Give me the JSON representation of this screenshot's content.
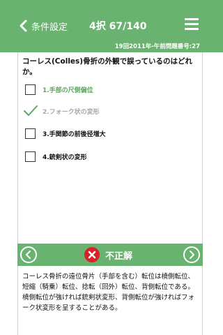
{
  "header": {
    "back_label": "条件設定",
    "counter": "4択 67/140",
    "exam_info": "19回2011年-午前問題番号:27"
  },
  "question": {
    "text": "コーレス(Colles)骨折の外観で誤っているのはどれか。"
  },
  "options": [
    {
      "label": "1.手部の尺側偏位",
      "state": "correct-answer",
      "checked": false
    },
    {
      "label": "2.フォーク状の変形",
      "state": "selected",
      "checked": true
    },
    {
      "label": "3.手関節の前後径増大",
      "state": "normal",
      "checked": false
    },
    {
      "label": "4.銃剣状の変形",
      "state": "normal",
      "checked": false
    }
  ],
  "result": {
    "text": "不正解"
  },
  "explanation": {
    "text": "コーレス骨折の遠位骨片（手部を含む）転位は橈側転位、短縮（騎乗）転位、捻転（回外）転位、背側転位である。橈側転位が強ければ銃剣状変形、背側転位が強ければフォーク状変形を呈することがある。"
  },
  "colors": {
    "theme_green": "#6ab26f",
    "correct_green": "#5aa85f",
    "wrong_red": "#d8222a"
  },
  "icons": {
    "back": "chevron-left-icon",
    "menu": "hamburger-menu-icon",
    "prev": "circle-chevron-left-icon",
    "next": "circle-chevron-right-icon",
    "wrong": "x-circle-icon",
    "check": "check-mark-icon"
  }
}
